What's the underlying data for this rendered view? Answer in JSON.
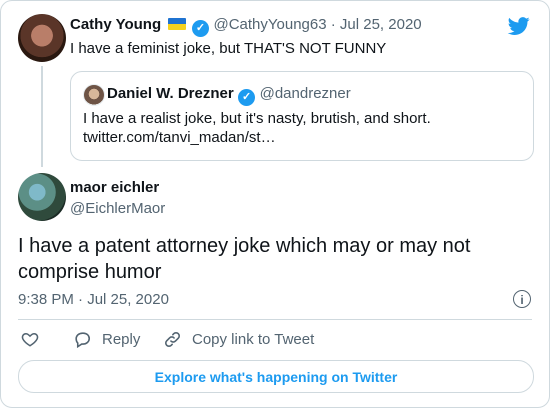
{
  "parent_tweet": {
    "author_name": "Cathy Young",
    "handle_date": "@CathyYoung63 · Jul 25, 2020",
    "text": "I have a feminist joke, but THAT'S NOT FUNNY",
    "flag_icon": "ukraine-flag-icon",
    "verified_color": "#1d9bf0"
  },
  "quoted_tweet": {
    "author_name": "Daniel W. Drezner",
    "handle": "@dandrezner",
    "text_line1": "I have a realist joke, but it's nasty, brutish, and short.",
    "text_line2": "twitter.com/tanvi_madan/st…"
  },
  "main_tweet": {
    "author_name": "maor eichler",
    "handle": "@EichlerMaor",
    "text": "I have a patent attorney joke which may or may not comprise humor",
    "timestamp": "9:38 PM · Jul 25, 2020"
  },
  "actions": {
    "reply_label": "Reply",
    "copy_link_label": "Copy link to Tweet"
  },
  "footer": {
    "explore_label": "Explore what's happening on Twitter"
  },
  "colors": {
    "accent": "#1d9bf0",
    "muted": "#536471",
    "border": "#cfd9de"
  }
}
